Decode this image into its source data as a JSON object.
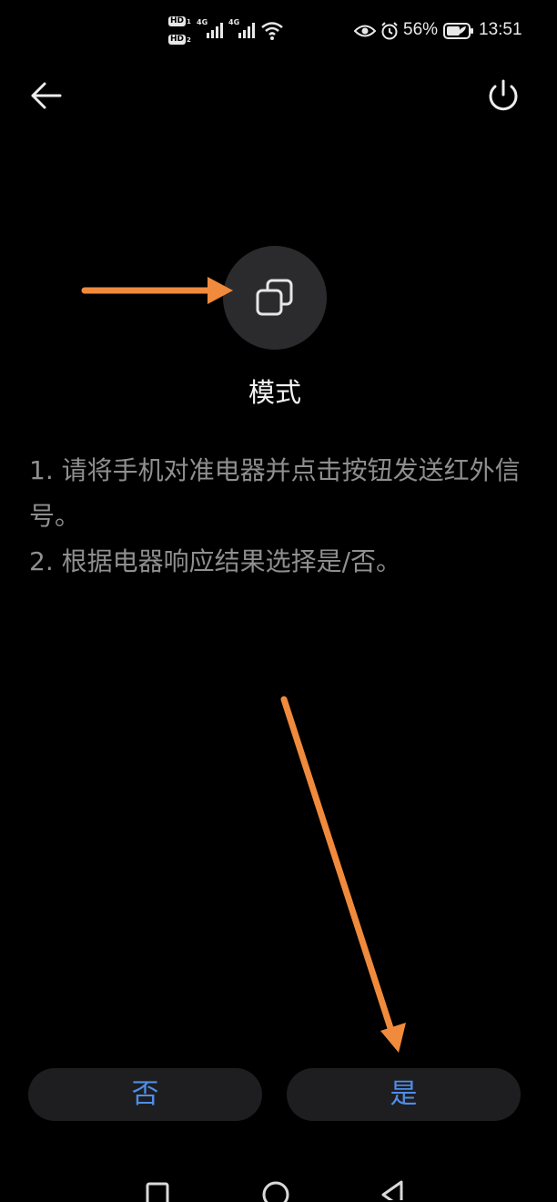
{
  "status_bar": {
    "hd1": "HD",
    "sim1": "1",
    "hd2": "HD",
    "sim2": "2",
    "net1": "4G",
    "net2": "4G",
    "battery": "56%",
    "time": "13:51"
  },
  "mode": {
    "label": "模式"
  },
  "instructions": [
    "1. 请将手机对准电器并点击按钮发送红外信号。",
    "2. 根据电器响应结果选择是/否。"
  ],
  "buttons": {
    "no": "否",
    "yes": "是"
  },
  "annotation_color": "#f08a3c",
  "accent_color": "#4f8de8"
}
